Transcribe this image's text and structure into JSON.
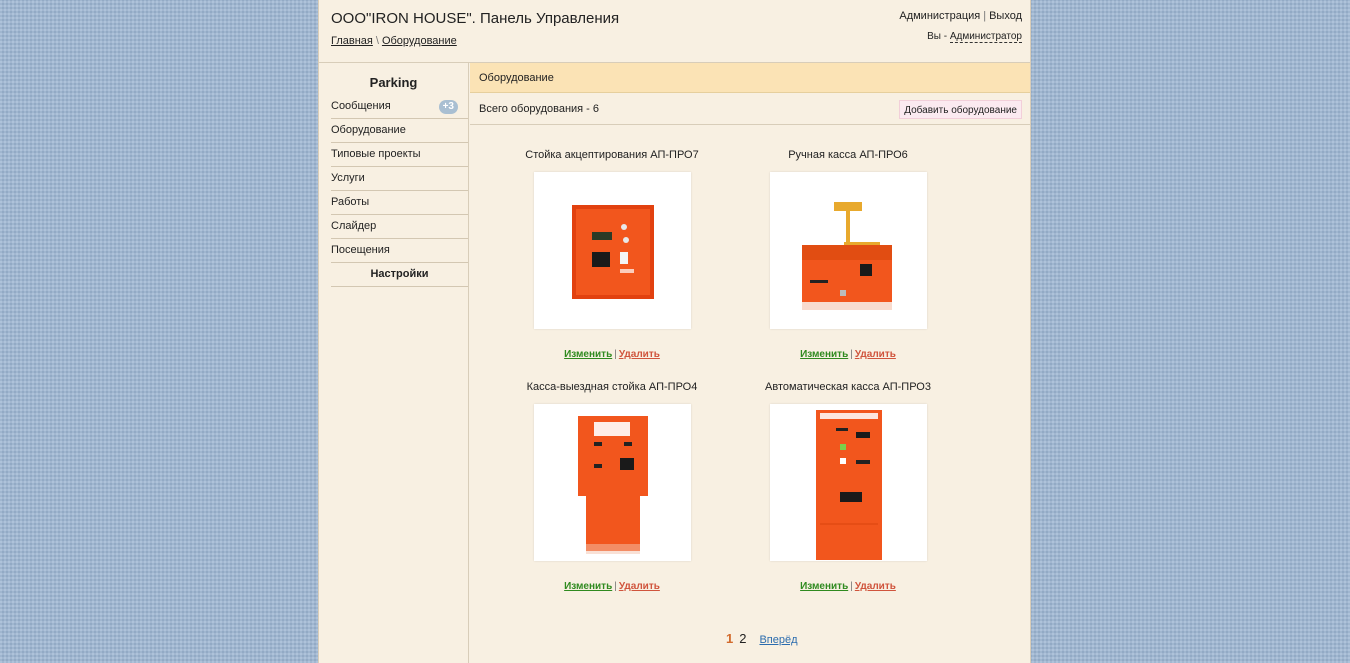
{
  "header": {
    "title": "ООО\"IRON HOUSE\". Панель Управления",
    "breadcrumb": {
      "home": "Главная",
      "sep": "\\",
      "current": "Оборудование"
    },
    "admin_link": "Администрация",
    "sep": "|",
    "logout_link": "Выход",
    "user_prefix": "Вы -",
    "user_name": "Администратор"
  },
  "sidebar": {
    "title": "Parking",
    "items": [
      {
        "label": "Сообщения",
        "badge": "+3"
      },
      {
        "label": "Оборудование"
      },
      {
        "label": "Типовые проекты"
      },
      {
        "label": "Услуги"
      },
      {
        "label": "Работы"
      },
      {
        "label": "Слайдер"
      },
      {
        "label": "Посещения"
      }
    ],
    "settings": "Настройки"
  },
  "main": {
    "section_title": "Оборудование",
    "total": "Всего оборудования - 6",
    "add_button": "Добавить оборудование",
    "items": [
      {
        "name": "Стойка акцептирования АП-ПРО7",
        "edit": "Изменить",
        "delete": "Удалить",
        "image_icon": "acceptance-stand-image"
      },
      {
        "name": "Ручная касса АП-ПРО6",
        "edit": "Изменить",
        "delete": "Удалить",
        "image_icon": "manual-cashbox-image"
      },
      {
        "name": "Касса-выездная стойка АП-ПРО4",
        "edit": "Изменить",
        "delete": "Удалить",
        "image_icon": "exit-stand-image"
      },
      {
        "name": "Автоматическая касса АП-ПРО3",
        "edit": "Изменить",
        "delete": "Удалить",
        "image_icon": "automatic-cashbox-image"
      }
    ],
    "item_sep": "|"
  },
  "pagination": {
    "current": "1",
    "page2": "2",
    "next": "Вперёд"
  },
  "colors": {
    "accent_orange": "#f2561d",
    "section_head_bg": "#fbe3b5",
    "edit_green": "#2f8a1f",
    "delete_red": "#d0543c",
    "page_bg": "#f8f0e2"
  }
}
